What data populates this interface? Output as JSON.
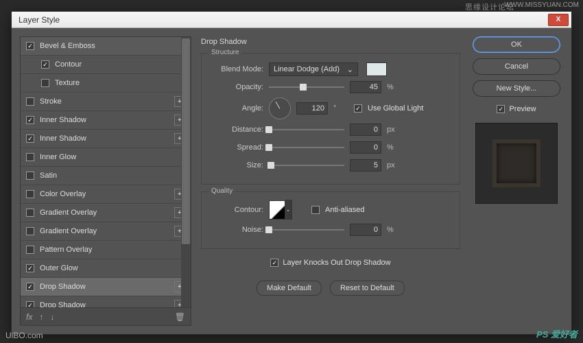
{
  "meta": {
    "watermark_top": "思缘设计论坛",
    "watermark_url": "WWW.MISSYUAN.COM",
    "watermark_bl": "UiBO.com",
    "watermark_br": "PS 爱好者"
  },
  "dialog": {
    "title": "Layer Style"
  },
  "stylesList": {
    "items": [
      {
        "label": "Bevel & Emboss",
        "checked": true,
        "top": true,
        "chevron": true
      },
      {
        "label": "Contour",
        "checked": true,
        "child": true
      },
      {
        "label": "Texture",
        "checked": false,
        "child": true
      },
      {
        "label": "Stroke",
        "checked": false,
        "plus": true
      },
      {
        "label": "Inner Shadow",
        "checked": true,
        "plus": true
      },
      {
        "label": "Inner Shadow",
        "checked": true,
        "plus": true
      },
      {
        "label": "Inner Glow",
        "checked": false
      },
      {
        "label": "Satin",
        "checked": false
      },
      {
        "label": "Color Overlay",
        "checked": false,
        "plus": true
      },
      {
        "label": "Gradient Overlay",
        "checked": false,
        "plus": true
      },
      {
        "label": "Gradient Overlay",
        "checked": false,
        "plus": true
      },
      {
        "label": "Pattern Overlay",
        "checked": false
      },
      {
        "label": "Outer Glow",
        "checked": true
      },
      {
        "label": "Drop Shadow",
        "checked": true,
        "plus": true,
        "selected": true
      },
      {
        "label": "Drop Shadow",
        "checked": true,
        "plus": true
      }
    ],
    "footer": {
      "fx": "fx",
      "up": "↑",
      "down": "↓",
      "trash": "🗑"
    }
  },
  "dropShadow": {
    "title": "Drop Shadow",
    "structure": {
      "legend": "Structure",
      "blendMode": {
        "label": "Blend Mode:",
        "value": "Linear Dodge (Add)",
        "swatch": "#dfe8e8"
      },
      "opacity": {
        "label": "Opacity:",
        "value": "45",
        "unit": "%",
        "pos": 45
      },
      "angle": {
        "label": "Angle:",
        "value": "120",
        "unit": "°",
        "useGlobal": {
          "label": "Use Global Light",
          "checked": true
        }
      },
      "distance": {
        "label": "Distance:",
        "value": "0",
        "unit": "px",
        "pos": 0
      },
      "spread": {
        "label": "Spread:",
        "value": "0",
        "unit": "%",
        "pos": 0
      },
      "size": {
        "label": "Size:",
        "value": "5",
        "unit": "px",
        "pos": 3
      }
    },
    "quality": {
      "legend": "Quality",
      "contour": {
        "label": "Contour:"
      },
      "antiAliased": {
        "label": "Anti-aliased",
        "checked": false
      },
      "noise": {
        "label": "Noise:",
        "value": "0",
        "unit": "%",
        "pos": 0
      }
    },
    "knockOut": {
      "label": "Layer Knocks Out Drop Shadow",
      "checked": true
    },
    "buttons": {
      "makeDefault": "Make Default",
      "resetDefault": "Reset to Default"
    }
  },
  "right": {
    "ok": "OK",
    "cancel": "Cancel",
    "newStyle": "New Style...",
    "preview": {
      "label": "Preview",
      "checked": true
    }
  }
}
